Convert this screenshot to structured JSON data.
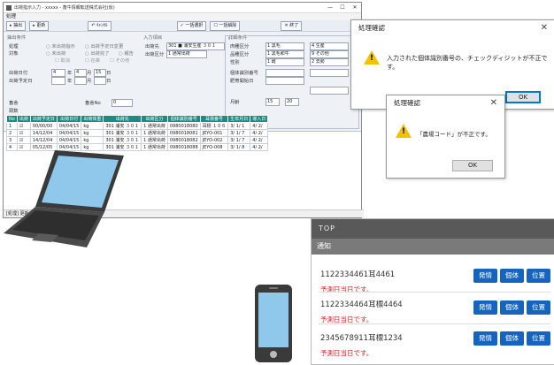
{
  "main": {
    "title": "出荷指示入力 - xxxxx - 畜牛情報転送株式会社(仮)",
    "menu": "処理",
    "toolbar": {
      "pick": "抽出",
      "update": "更新",
      "cancel": "ｷｬﾝｾﾙ",
      "all_select": "一括選択",
      "all_release": "一括解除",
      "close": "終了"
    },
    "left": {
      "section": "抽出条件",
      "process": "処理",
      "target": "対象",
      "opt1": "未出荷指示",
      "opt2": "出荷予定日変更",
      "opt3": "未出荷",
      "opt4": "出荷完了",
      "opt5": "報告",
      "opt6": "取消",
      "opt7": "在庫",
      "opt8": "その他",
      "ship_date": "出荷日付",
      "ship_plan": "出荷予定日",
      "y": "年",
      "m": "月",
      "d": "日",
      "plan_y": "4",
      "plan_m": "4",
      "plan_d": "15",
      "bldg": "畜舎",
      "count": "頭数",
      "cattle_no": "畜舎No",
      "cattle_no_val": "0"
    },
    "middle": {
      "section": "入力項目",
      "dest": "出荷先",
      "dest_val": "301 ■ 浦安生産 ３０１",
      "ship_type": "出荷区分",
      "ship_type_val": "1 通常出荷"
    },
    "right": {
      "section": "詳細条件",
      "breed": "肉種区分",
      "kind": "品種区分",
      "sex": "性別",
      "breed_val": "1 黒毛",
      "breed_val2": "4 生産",
      "kind_val": "1 黒毛和牛",
      "kind_val2": "9 その他",
      "sex_val": "1 雌",
      "sex_val2": "2 去勢",
      "indiv": "個体識別番号",
      "arrival": "肥育開始日",
      "age": "月齢",
      "age_from": "15",
      "age_to": "20"
    },
    "grid": {
      "headers": [
        "No",
        "出荷",
        "出荷予定日",
        "出荷日付",
        "出荷体重",
        "出荷先",
        "出荷区分",
        "個体識別番号",
        "耳標番号",
        "生年月日",
        "導入日"
      ],
      "rows": [
        [
          "1",
          "00/00/00",
          "04/04/15",
          "kg",
          "301 浦安 ３０１",
          "1 通常出荷",
          "0980018080",
          "耳標 １０６",
          "3/ 1/ 1",
          "4/ 2/"
        ],
        [
          "2",
          "14/12/04",
          "04/04/15",
          "kg",
          "301 浦安 ３０１",
          "1 通常出荷",
          "0980018081",
          "JEYO-001",
          "3/ 1/ 7",
          "4/ 2/"
        ],
        [
          "3",
          "14/12/04",
          "04/04/15",
          "kg",
          "301 浦安 ３０１",
          "1 通常出荷",
          "0980018082",
          "JEYO-002",
          "3/ 1/ 7",
          "4/ 2/"
        ],
        [
          "4",
          "05/12/05",
          "04/04/15",
          "kg",
          "301 浦安 ３０１",
          "1 通常出荷",
          "0980018088",
          "JEYO-008",
          "3/ 1/ 8",
          "4/ 2/"
        ]
      ]
    },
    "status": "[処理] 更新入力"
  },
  "dialog1": {
    "title": "処理確認",
    "message": "入力された個体識別番号の、チェックディジットが不正です。",
    "ok": "OK"
  },
  "dialog2": {
    "title": "処理確認",
    "message": "「農場コード」が不正です。",
    "ok": "OK"
  },
  "mobile": {
    "top": "TOP",
    "notice": "通知",
    "items": [
      {
        "id": "1122334461耳4461",
        "due": "予測日当日です。"
      },
      {
        "id": "1122334464耳標4464",
        "due": "予測日当日です。"
      },
      {
        "id": "2345678911耳標1234",
        "due": "予測日当日です。"
      }
    ],
    "btn_ship": "発情",
    "btn_indiv": "個体",
    "btn_pos": "位置"
  }
}
